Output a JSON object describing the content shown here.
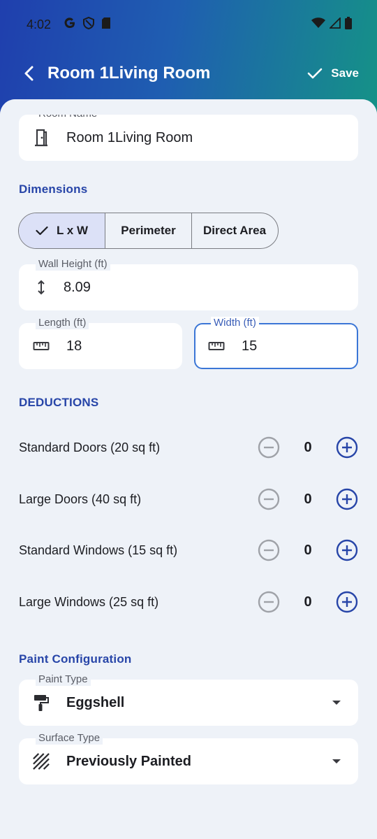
{
  "status_bar": {
    "time": "4:02"
  },
  "app_bar": {
    "title": "Room 1Living Room",
    "save_label": "Save"
  },
  "room_name": {
    "label": "Room Name",
    "value": "Room 1Living Room"
  },
  "dimensions": {
    "section_title": "Dimensions",
    "modes": [
      "L x W",
      "Perimeter",
      "Direct Area"
    ],
    "selected_mode": "L x W",
    "wall_height": {
      "label": "Wall Height (ft)",
      "value": "8.09"
    },
    "length": {
      "label": "Length (ft)",
      "value": "18"
    },
    "width": {
      "label": "Width (ft)",
      "value": "15"
    }
  },
  "deductions": {
    "section_title": "DEDUCTIONS",
    "items": [
      {
        "label": "Standard Doors (20 sq ft)",
        "count": "0"
      },
      {
        "label": "Large Doors (40 sq ft)",
        "count": "0"
      },
      {
        "label": "Standard Windows (15 sq ft)",
        "count": "0"
      },
      {
        "label": "Large Windows (25 sq ft)",
        "count": "0"
      }
    ]
  },
  "paint_configuration": {
    "section_title": "Paint Configuration",
    "paint_type": {
      "label": "Paint Type",
      "value": "Eggshell"
    },
    "surface_type": {
      "label": "Surface Type",
      "value": "Previously Painted"
    }
  },
  "colors": {
    "accent": "#2745a8",
    "focus_border": "#3b76d6",
    "chip_selected": "#dce1f7"
  }
}
